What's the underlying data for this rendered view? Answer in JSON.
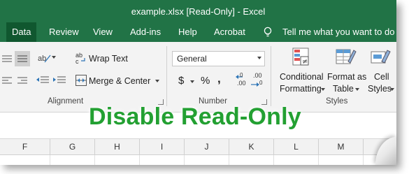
{
  "window": {
    "title": "example.xlsx  [Read-Only]  -  Excel"
  },
  "tabs": [
    {
      "label": "Data",
      "active": true
    },
    {
      "label": "Review"
    },
    {
      "label": "View"
    },
    {
      "label": "Add-ins"
    },
    {
      "label": "Help"
    },
    {
      "label": "Acrobat"
    }
  ],
  "tell_me": {
    "icon": "lightbulb-icon",
    "label": "Tell me what you want to do"
  },
  "alignment": {
    "wrap_text": "Wrap Text",
    "merge_center": "Merge & Center",
    "group_label": "Alignment"
  },
  "number": {
    "format_value": "General",
    "currency": "$",
    "percent": "%",
    "comma": ",",
    "increase_decimal": ".00",
    "decrease_decimal": ".00",
    "group_label": "Number"
  },
  "styles": {
    "conditional_formatting": [
      "Conditional",
      "Formatting"
    ],
    "format_as_table": [
      "Format as",
      "Table"
    ],
    "cell_styles": [
      "Cell",
      "Styles"
    ],
    "group_label": "Styles"
  },
  "columns": [
    "F",
    "G",
    "H",
    "I",
    "J",
    "K",
    "L",
    "M"
  ],
  "overlay_caption": "Disable Read-Only",
  "colors": {
    "excel_green": "#217346",
    "active_tab": "#10572f",
    "caption_green": "#23a032"
  }
}
